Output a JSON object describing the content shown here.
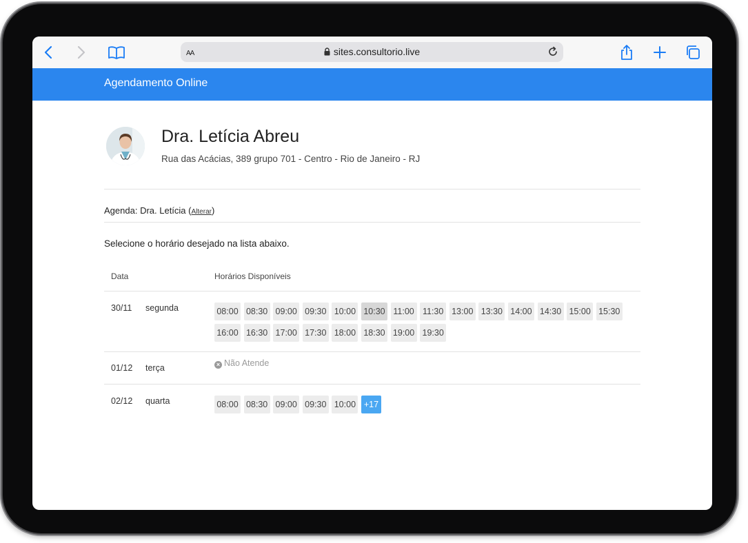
{
  "browser": {
    "text_size_label": "AA",
    "url": "sites.consultorio.live"
  },
  "header": {
    "title": "Agendamento Online"
  },
  "doctor": {
    "name": "Dra. Letícia Abreu",
    "address": "Rua das Acácias, 389 grupo 701 - Centro - Rio de Janeiro - RJ"
  },
  "agenda": {
    "label": "Agenda",
    "value": "Dra. Letícia",
    "change_link": "Alterar"
  },
  "instruction": "Selecione o horário desejado na lista abaixo.",
  "table": {
    "col_date": "Data",
    "col_times": "Horários Disponíveis",
    "rows": [
      {
        "date": "30/11",
        "weekday": "segunda",
        "slots": [
          "08:00",
          "08:30",
          "09:00",
          "09:30",
          "10:00",
          "10:30",
          "11:00",
          "11:30",
          "13:00",
          "13:30",
          "14:00",
          "14:30",
          "15:00",
          "15:30",
          "16:00",
          "16:30",
          "17:00",
          "17:30",
          "18:00",
          "18:30",
          "19:00",
          "19:30"
        ],
        "highlighted": "10:30"
      },
      {
        "date": "01/12",
        "weekday": "terça",
        "closed_label": "Não Atende"
      },
      {
        "date": "02/12",
        "weekday": "quarta",
        "slots": [
          "08:00",
          "08:30",
          "09:00",
          "09:30",
          "10:00"
        ],
        "more_label": "+17"
      }
    ]
  },
  "colors": {
    "header_blue": "#2b86ee",
    "more_button_blue": "#4aa7f2",
    "browser_icon_blue": "#1a7cf5"
  }
}
